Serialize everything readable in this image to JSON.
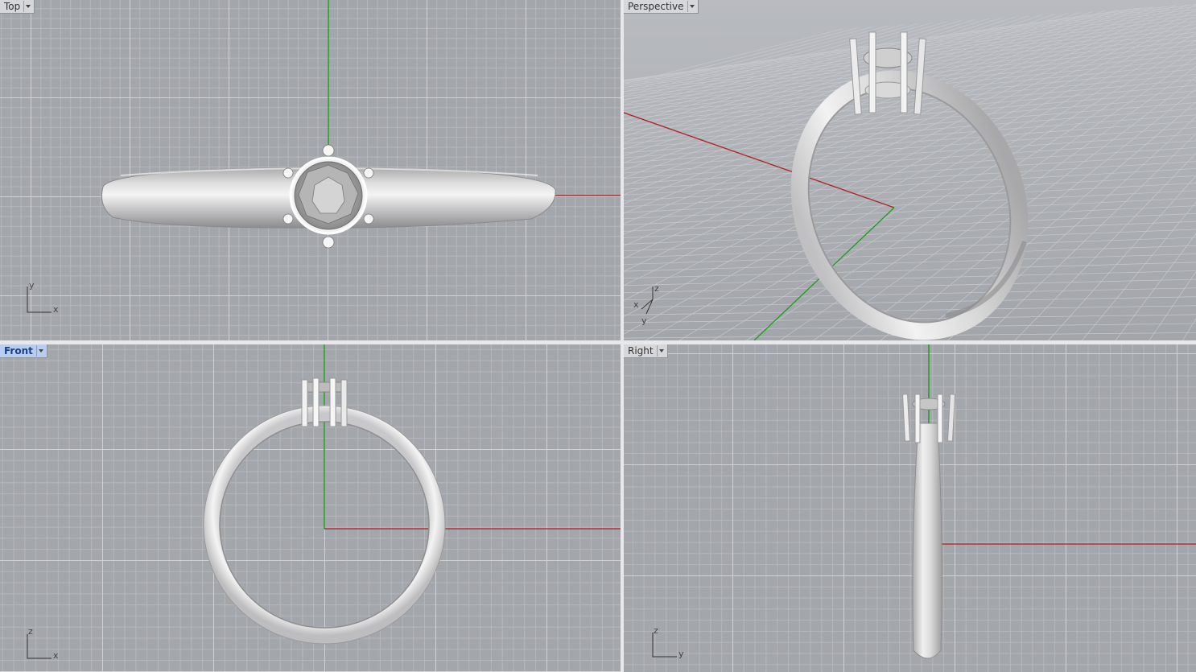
{
  "viewports": {
    "top": {
      "label": "Top",
      "active": false
    },
    "perspective": {
      "label": "Perspective",
      "active": false
    },
    "front": {
      "label": "Front",
      "active": true
    },
    "right": {
      "label": "Right",
      "active": false
    }
  },
  "axis_labels": {
    "top": [
      "y",
      "x"
    ],
    "perspective": [
      "z",
      "x",
      "y"
    ],
    "front": [
      "z",
      "x"
    ],
    "right": [
      "z",
      "y"
    ]
  },
  "colors": {
    "viewport_bg": "#a3a6ab",
    "x_axis": "#b02020",
    "y_axis": "#1f9a1f",
    "active_tab": "#b8cdf0",
    "divider": "#e8e8ea"
  },
  "icons": {
    "viewport_menu": "chevron-down-icon",
    "world_axes": "axes-icon"
  }
}
